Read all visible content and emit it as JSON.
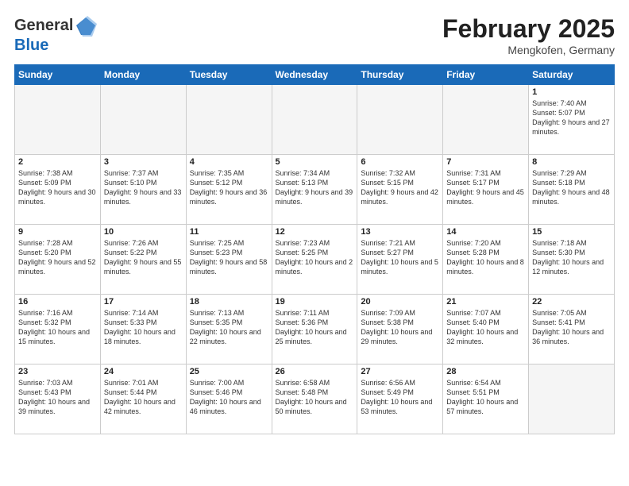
{
  "header": {
    "logo_general": "General",
    "logo_blue": "Blue",
    "month_title": "February 2025",
    "location": "Mengkofen, Germany"
  },
  "days_of_week": [
    "Sunday",
    "Monday",
    "Tuesday",
    "Wednesday",
    "Thursday",
    "Friday",
    "Saturday"
  ],
  "weeks": [
    [
      {
        "day": "",
        "info": ""
      },
      {
        "day": "",
        "info": ""
      },
      {
        "day": "",
        "info": ""
      },
      {
        "day": "",
        "info": ""
      },
      {
        "day": "",
        "info": ""
      },
      {
        "day": "",
        "info": ""
      },
      {
        "day": "1",
        "info": "Sunrise: 7:40 AM\nSunset: 5:07 PM\nDaylight: 9 hours and 27 minutes."
      }
    ],
    [
      {
        "day": "2",
        "info": "Sunrise: 7:38 AM\nSunset: 5:09 PM\nDaylight: 9 hours and 30 minutes."
      },
      {
        "day": "3",
        "info": "Sunrise: 7:37 AM\nSunset: 5:10 PM\nDaylight: 9 hours and 33 minutes."
      },
      {
        "day": "4",
        "info": "Sunrise: 7:35 AM\nSunset: 5:12 PM\nDaylight: 9 hours and 36 minutes."
      },
      {
        "day": "5",
        "info": "Sunrise: 7:34 AM\nSunset: 5:13 PM\nDaylight: 9 hours and 39 minutes."
      },
      {
        "day": "6",
        "info": "Sunrise: 7:32 AM\nSunset: 5:15 PM\nDaylight: 9 hours and 42 minutes."
      },
      {
        "day": "7",
        "info": "Sunrise: 7:31 AM\nSunset: 5:17 PM\nDaylight: 9 hours and 45 minutes."
      },
      {
        "day": "8",
        "info": "Sunrise: 7:29 AM\nSunset: 5:18 PM\nDaylight: 9 hours and 48 minutes."
      }
    ],
    [
      {
        "day": "9",
        "info": "Sunrise: 7:28 AM\nSunset: 5:20 PM\nDaylight: 9 hours and 52 minutes."
      },
      {
        "day": "10",
        "info": "Sunrise: 7:26 AM\nSunset: 5:22 PM\nDaylight: 9 hours and 55 minutes."
      },
      {
        "day": "11",
        "info": "Sunrise: 7:25 AM\nSunset: 5:23 PM\nDaylight: 9 hours and 58 minutes."
      },
      {
        "day": "12",
        "info": "Sunrise: 7:23 AM\nSunset: 5:25 PM\nDaylight: 10 hours and 2 minutes."
      },
      {
        "day": "13",
        "info": "Sunrise: 7:21 AM\nSunset: 5:27 PM\nDaylight: 10 hours and 5 minutes."
      },
      {
        "day": "14",
        "info": "Sunrise: 7:20 AM\nSunset: 5:28 PM\nDaylight: 10 hours and 8 minutes."
      },
      {
        "day": "15",
        "info": "Sunrise: 7:18 AM\nSunset: 5:30 PM\nDaylight: 10 hours and 12 minutes."
      }
    ],
    [
      {
        "day": "16",
        "info": "Sunrise: 7:16 AM\nSunset: 5:32 PM\nDaylight: 10 hours and 15 minutes."
      },
      {
        "day": "17",
        "info": "Sunrise: 7:14 AM\nSunset: 5:33 PM\nDaylight: 10 hours and 18 minutes."
      },
      {
        "day": "18",
        "info": "Sunrise: 7:13 AM\nSunset: 5:35 PM\nDaylight: 10 hours and 22 minutes."
      },
      {
        "day": "19",
        "info": "Sunrise: 7:11 AM\nSunset: 5:36 PM\nDaylight: 10 hours and 25 minutes."
      },
      {
        "day": "20",
        "info": "Sunrise: 7:09 AM\nSunset: 5:38 PM\nDaylight: 10 hours and 29 minutes."
      },
      {
        "day": "21",
        "info": "Sunrise: 7:07 AM\nSunset: 5:40 PM\nDaylight: 10 hours and 32 minutes."
      },
      {
        "day": "22",
        "info": "Sunrise: 7:05 AM\nSunset: 5:41 PM\nDaylight: 10 hours and 36 minutes."
      }
    ],
    [
      {
        "day": "23",
        "info": "Sunrise: 7:03 AM\nSunset: 5:43 PM\nDaylight: 10 hours and 39 minutes."
      },
      {
        "day": "24",
        "info": "Sunrise: 7:01 AM\nSunset: 5:44 PM\nDaylight: 10 hours and 42 minutes."
      },
      {
        "day": "25",
        "info": "Sunrise: 7:00 AM\nSunset: 5:46 PM\nDaylight: 10 hours and 46 minutes."
      },
      {
        "day": "26",
        "info": "Sunrise: 6:58 AM\nSunset: 5:48 PM\nDaylight: 10 hours and 50 minutes."
      },
      {
        "day": "27",
        "info": "Sunrise: 6:56 AM\nSunset: 5:49 PM\nDaylight: 10 hours and 53 minutes."
      },
      {
        "day": "28",
        "info": "Sunrise: 6:54 AM\nSunset: 5:51 PM\nDaylight: 10 hours and 57 minutes."
      },
      {
        "day": "",
        "info": ""
      }
    ]
  ]
}
